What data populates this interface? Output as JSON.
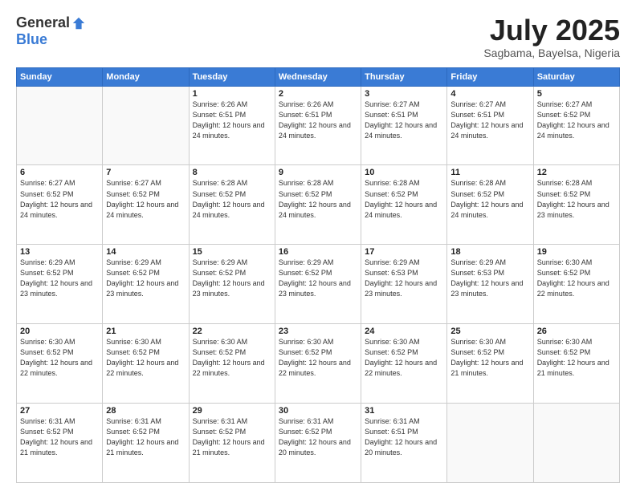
{
  "header": {
    "logo_general": "General",
    "logo_blue": "Blue",
    "month_title": "July 2025",
    "location": "Sagbama, Bayelsa, Nigeria"
  },
  "days_of_week": [
    "Sunday",
    "Monday",
    "Tuesday",
    "Wednesday",
    "Thursday",
    "Friday",
    "Saturday"
  ],
  "weeks": [
    [
      {
        "day": "",
        "info": ""
      },
      {
        "day": "",
        "info": ""
      },
      {
        "day": "1",
        "info": "Sunrise: 6:26 AM\nSunset: 6:51 PM\nDaylight: 12 hours and 24 minutes."
      },
      {
        "day": "2",
        "info": "Sunrise: 6:26 AM\nSunset: 6:51 PM\nDaylight: 12 hours and 24 minutes."
      },
      {
        "day": "3",
        "info": "Sunrise: 6:27 AM\nSunset: 6:51 PM\nDaylight: 12 hours and 24 minutes."
      },
      {
        "day": "4",
        "info": "Sunrise: 6:27 AM\nSunset: 6:51 PM\nDaylight: 12 hours and 24 minutes."
      },
      {
        "day": "5",
        "info": "Sunrise: 6:27 AM\nSunset: 6:52 PM\nDaylight: 12 hours and 24 minutes."
      }
    ],
    [
      {
        "day": "6",
        "info": "Sunrise: 6:27 AM\nSunset: 6:52 PM\nDaylight: 12 hours and 24 minutes."
      },
      {
        "day": "7",
        "info": "Sunrise: 6:27 AM\nSunset: 6:52 PM\nDaylight: 12 hours and 24 minutes."
      },
      {
        "day": "8",
        "info": "Sunrise: 6:28 AM\nSunset: 6:52 PM\nDaylight: 12 hours and 24 minutes."
      },
      {
        "day": "9",
        "info": "Sunrise: 6:28 AM\nSunset: 6:52 PM\nDaylight: 12 hours and 24 minutes."
      },
      {
        "day": "10",
        "info": "Sunrise: 6:28 AM\nSunset: 6:52 PM\nDaylight: 12 hours and 24 minutes."
      },
      {
        "day": "11",
        "info": "Sunrise: 6:28 AM\nSunset: 6:52 PM\nDaylight: 12 hours and 24 minutes."
      },
      {
        "day": "12",
        "info": "Sunrise: 6:28 AM\nSunset: 6:52 PM\nDaylight: 12 hours and 23 minutes."
      }
    ],
    [
      {
        "day": "13",
        "info": "Sunrise: 6:29 AM\nSunset: 6:52 PM\nDaylight: 12 hours and 23 minutes."
      },
      {
        "day": "14",
        "info": "Sunrise: 6:29 AM\nSunset: 6:52 PM\nDaylight: 12 hours and 23 minutes."
      },
      {
        "day": "15",
        "info": "Sunrise: 6:29 AM\nSunset: 6:52 PM\nDaylight: 12 hours and 23 minutes."
      },
      {
        "day": "16",
        "info": "Sunrise: 6:29 AM\nSunset: 6:52 PM\nDaylight: 12 hours and 23 minutes."
      },
      {
        "day": "17",
        "info": "Sunrise: 6:29 AM\nSunset: 6:53 PM\nDaylight: 12 hours and 23 minutes."
      },
      {
        "day": "18",
        "info": "Sunrise: 6:29 AM\nSunset: 6:53 PM\nDaylight: 12 hours and 23 minutes."
      },
      {
        "day": "19",
        "info": "Sunrise: 6:30 AM\nSunset: 6:52 PM\nDaylight: 12 hours and 22 minutes."
      }
    ],
    [
      {
        "day": "20",
        "info": "Sunrise: 6:30 AM\nSunset: 6:52 PM\nDaylight: 12 hours and 22 minutes."
      },
      {
        "day": "21",
        "info": "Sunrise: 6:30 AM\nSunset: 6:52 PM\nDaylight: 12 hours and 22 minutes."
      },
      {
        "day": "22",
        "info": "Sunrise: 6:30 AM\nSunset: 6:52 PM\nDaylight: 12 hours and 22 minutes."
      },
      {
        "day": "23",
        "info": "Sunrise: 6:30 AM\nSunset: 6:52 PM\nDaylight: 12 hours and 22 minutes."
      },
      {
        "day": "24",
        "info": "Sunrise: 6:30 AM\nSunset: 6:52 PM\nDaylight: 12 hours and 22 minutes."
      },
      {
        "day": "25",
        "info": "Sunrise: 6:30 AM\nSunset: 6:52 PM\nDaylight: 12 hours and 21 minutes."
      },
      {
        "day": "26",
        "info": "Sunrise: 6:30 AM\nSunset: 6:52 PM\nDaylight: 12 hours and 21 minutes."
      }
    ],
    [
      {
        "day": "27",
        "info": "Sunrise: 6:31 AM\nSunset: 6:52 PM\nDaylight: 12 hours and 21 minutes."
      },
      {
        "day": "28",
        "info": "Sunrise: 6:31 AM\nSunset: 6:52 PM\nDaylight: 12 hours and 21 minutes."
      },
      {
        "day": "29",
        "info": "Sunrise: 6:31 AM\nSunset: 6:52 PM\nDaylight: 12 hours and 21 minutes."
      },
      {
        "day": "30",
        "info": "Sunrise: 6:31 AM\nSunset: 6:52 PM\nDaylight: 12 hours and 20 minutes."
      },
      {
        "day": "31",
        "info": "Sunrise: 6:31 AM\nSunset: 6:51 PM\nDaylight: 12 hours and 20 minutes."
      },
      {
        "day": "",
        "info": ""
      },
      {
        "day": "",
        "info": ""
      }
    ]
  ]
}
